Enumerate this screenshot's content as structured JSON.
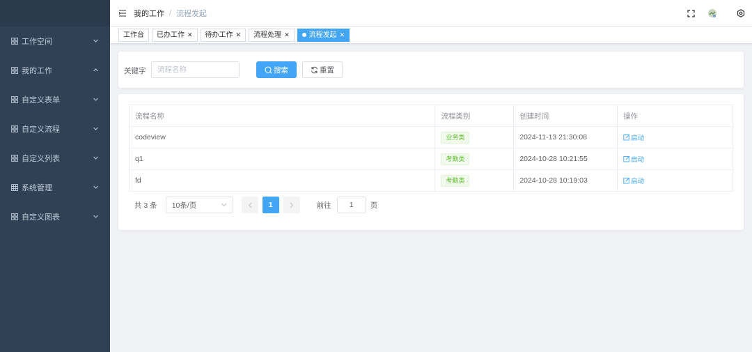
{
  "sidebar": {
    "items": [
      {
        "label": "工作空间",
        "expanded": false,
        "icon": "grid-icon"
      },
      {
        "label": "我的工作",
        "expanded": true,
        "icon": "grid-icon"
      },
      {
        "label": "自定义表单",
        "expanded": false,
        "icon": "grid-icon"
      },
      {
        "label": "自定义流程",
        "expanded": false,
        "icon": "grid-icon"
      },
      {
        "label": "自定义列表",
        "expanded": false,
        "icon": "grid-icon"
      },
      {
        "label": "系统管理",
        "expanded": false,
        "icon": "table-icon"
      },
      {
        "label": "自定义图表",
        "expanded": false,
        "icon": "grid-icon"
      }
    ]
  },
  "header": {
    "breadcrumb": [
      "我的工作",
      "流程发起"
    ],
    "breadcrumb_separator": "/"
  },
  "tags": [
    {
      "label": "工作台",
      "closable": false,
      "active": false
    },
    {
      "label": "已办工作",
      "closable": true,
      "active": false
    },
    {
      "label": "待办工作",
      "closable": true,
      "active": false
    },
    {
      "label": "流程处理",
      "closable": true,
      "active": false
    },
    {
      "label": "流程发起",
      "closable": true,
      "active": true
    }
  ],
  "search": {
    "label": "关键字",
    "placeholder": "流程名称",
    "value": "",
    "search_button": "搜索",
    "reset_button": "重置"
  },
  "table": {
    "columns": [
      "流程名称",
      "流程类别",
      "创建时间",
      "操作"
    ],
    "rows": [
      {
        "name": "codeview",
        "category": "业务类",
        "created": "2024-11-13 21:30:08",
        "action": "启动"
      },
      {
        "name": "q1",
        "category": "考勤类",
        "created": "2024-10-28 10:21:55",
        "action": "启动"
      },
      {
        "name": "fd",
        "category": "考勤类",
        "created": "2024-10-28 10:19:03",
        "action": "启动"
      }
    ]
  },
  "pagination": {
    "total_text": "共 3 条",
    "page_size": "10条/页",
    "current_page": "1",
    "goto_label": "前往",
    "goto_value": "1",
    "page_suffix": "页"
  },
  "colors": {
    "sidebar_bg": "#304156",
    "primary": "#42a5f5",
    "success_tag": "#67c23a"
  }
}
